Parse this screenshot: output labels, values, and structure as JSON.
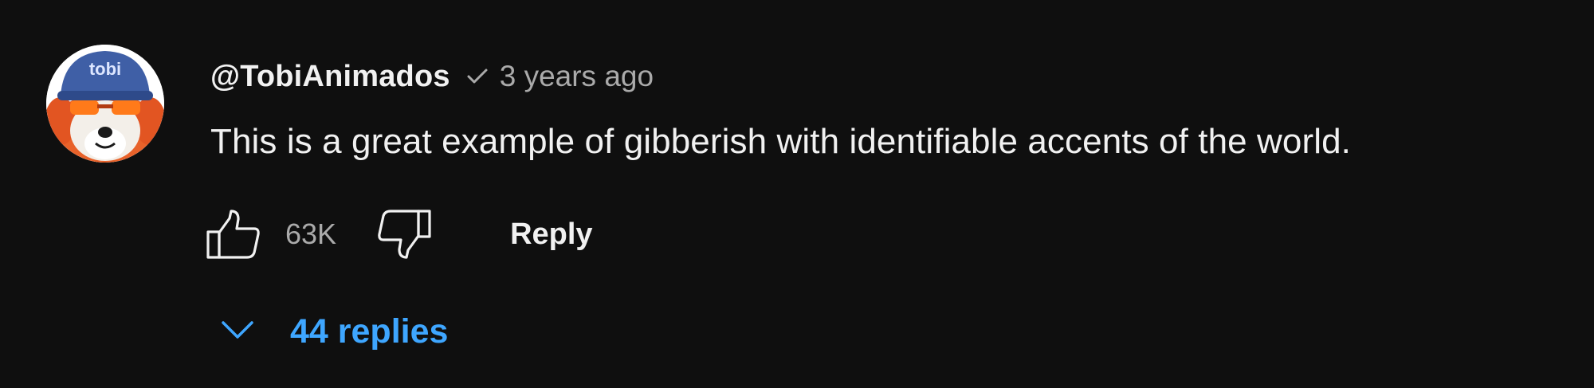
{
  "comment": {
    "author": "@TobiAnimados",
    "verified_icon": "checkmark-icon",
    "time": "3 years ago",
    "text": "This is a great example of gibberish with identifiable accents of the world.",
    "avatar": {
      "icon": "avatar-image",
      "cap_text": "tobi"
    },
    "actions": {
      "like_icon": "thumbs-up-icon",
      "like_count": "63K",
      "dislike_icon": "thumbs-down-icon",
      "reply_label": "Reply"
    },
    "replies": {
      "icon": "chevron-down-icon",
      "label": "44 replies"
    }
  },
  "colors": {
    "background": "#0f0f0f",
    "text_primary": "#f1f1f1",
    "text_secondary": "#aaaaaa",
    "link_blue": "#3ea6ff"
  }
}
